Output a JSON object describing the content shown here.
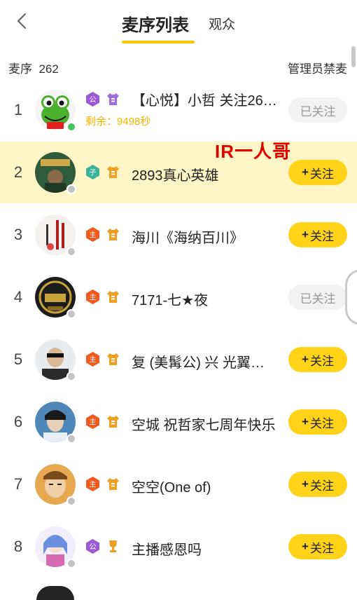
{
  "header": {
    "tab_active": "麦序列表",
    "tab_other": "观众"
  },
  "subbar": {
    "queue_label": "麦序",
    "queue_count": "262",
    "admin_label": "管理员禁麦"
  },
  "overlay_text": "IR一人哥",
  "rows": [
    {
      "rank": "1",
      "name": "【心悦】小哲  关注26…",
      "remain": "剩余：9498秒",
      "button": "已关注"
    },
    {
      "rank": "2",
      "name": "2893真心英雄",
      "button_plus": "+",
      "button": "关注"
    },
    {
      "rank": "3",
      "name": "海川《海纳百川》",
      "button_plus": "+",
      "button": "关注"
    },
    {
      "rank": "4",
      "name": "7171-七★夜",
      "button": "已关注"
    },
    {
      "rank": "5",
      "name": "复 (美髯公) 兴  光翼…",
      "button_plus": "+",
      "button": "关注"
    },
    {
      "rank": "6",
      "name": "空城 祝哲家七周年快乐",
      "button_plus": "+",
      "button": "关注"
    },
    {
      "rank": "7",
      "name": "空空(One of)",
      "button_plus": "+",
      "button": "关注"
    },
    {
      "rank": "8",
      "name": "主播感恩吗",
      "button_plus": "+",
      "button": "关注"
    }
  ],
  "colors": {
    "accent": "#ffc400",
    "follow_button": "#ffd31a",
    "highlight_row": "#fff5c7",
    "overlay_red": "#e00000"
  }
}
